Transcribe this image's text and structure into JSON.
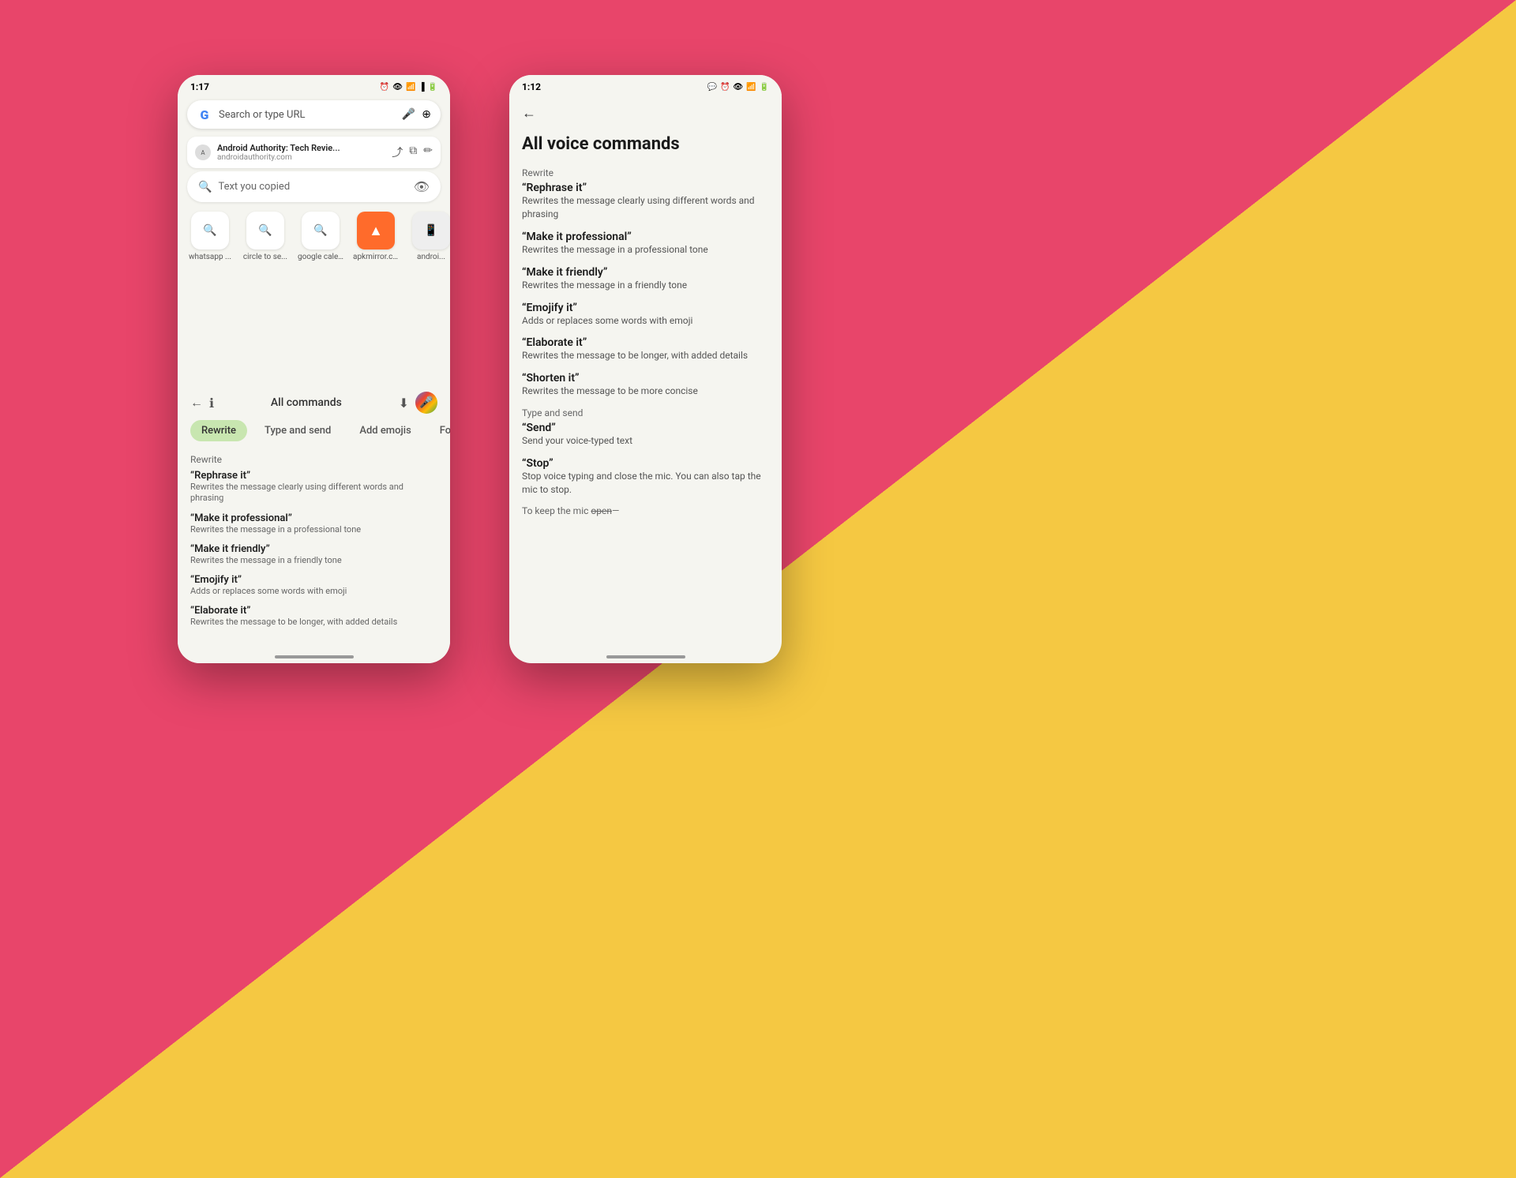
{
  "background": {
    "left_color": "#E8456A",
    "right_color": "#F5C842"
  },
  "phone_left": {
    "status": {
      "time": "1:17",
      "icons": "⏰ 👁 📶 🔋"
    },
    "search_bar": {
      "placeholder": "Search or type URL"
    },
    "tab": {
      "title": "Android Authority: Tech Revie...",
      "url": "androidauthority.com"
    },
    "clipboard": {
      "text": "Text you copied"
    },
    "shortcuts": [
      {
        "label": "whatsapp ...",
        "icon": "🔍"
      },
      {
        "label": "circle to se...",
        "icon": "🔍"
      },
      {
        "label": "google cale...",
        "icon": "🔍"
      },
      {
        "label": "apkmirror.c...",
        "icon": "A"
      },
      {
        "label": "androi...",
        "icon": "🔍"
      }
    ],
    "voice_panel": {
      "title": "All commands",
      "tabs": [
        {
          "label": "Rewrite",
          "active": true
        },
        {
          "label": "Type and send",
          "active": false
        },
        {
          "label": "Add emojis",
          "active": false
        },
        {
          "label": "Fo",
          "active": false
        }
      ],
      "section": "Rewrite",
      "commands": [
        {
          "name": "“Rephrase it”",
          "desc": "Rewrites the message clearly using different words and phrasing"
        },
        {
          "name": "“Make it professional”",
          "desc": "Rewrites the message in a professional tone"
        },
        {
          "name": "“Make it friendly”",
          "desc": "Rewrites the message in a friendly tone"
        },
        {
          "name": "“Emojify it”",
          "desc": "Adds or replaces some words with emoji"
        },
        {
          "name": "“Elaborate it”",
          "desc": "Rewrites the message to be longer, with added details"
        }
      ]
    }
  },
  "phone_right": {
    "status": {
      "time": "1:12",
      "icons": "⏰ 👁 📶 🔋"
    },
    "title": "All voice commands",
    "sections": [
      {
        "header": "Rewrite",
        "commands": [
          {
            "name": "“Rephrase it”",
            "desc": "Rewrites the message clearly using different words and phrasing"
          },
          {
            "name": "“Make it professional”",
            "desc": "Rewrites the message in a professional tone"
          },
          {
            "name": "“Make it friendly”",
            "desc": "Rewrites the message in a friendly tone"
          },
          {
            "name": "“Emojify it”",
            "desc": "Adds or replaces some words with emoji"
          },
          {
            "name": "“Elaborate it”",
            "desc": "Rewrites the message to be longer, with added details"
          },
          {
            "name": "“Shorten it”",
            "desc": "Rewrites the message to be more concise"
          }
        ]
      },
      {
        "header": "Type and send",
        "commands": [
          {
            "name": "“Send”",
            "desc": "Send your voice-typed text"
          },
          {
            "name": "“Stop”",
            "desc": "Stop voice typing and close the mic. You can also tap the mic to stop."
          }
        ]
      },
      {
        "header": "To keep the mic open—",
        "commands": [],
        "strikethrough_header": true
      }
    ]
  }
}
